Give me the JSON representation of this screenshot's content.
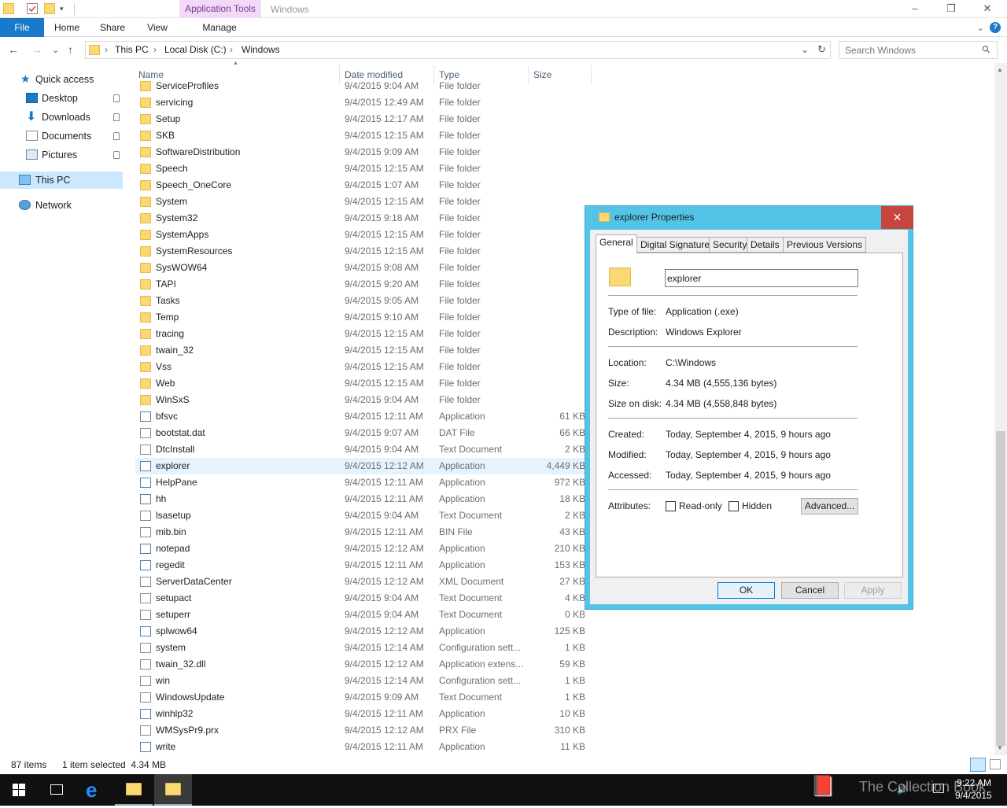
{
  "titlebar": {
    "context_tab": "Application Tools",
    "window_title": "Windows",
    "min": "–",
    "restore": "❐",
    "close": "✕"
  },
  "ribbon": {
    "tabs": [
      "File",
      "Home",
      "Share",
      "View",
      "Manage"
    ],
    "expand_icon": "⌄",
    "help_icon": "?"
  },
  "nav": {
    "back": "←",
    "forward": "→",
    "recent": "⌄",
    "up": "↑",
    "crumbs": [
      "This PC",
      "Local Disk (C:)",
      "Windows"
    ],
    "separator": "›",
    "dropdown": "⌄",
    "refresh": "↻",
    "search_placeholder": "Search Windows",
    "search_icon": "⚲"
  },
  "sidebar": {
    "items": [
      {
        "label": "Quick access",
        "icon": "star-icon"
      },
      {
        "label": "Desktop",
        "icon": "desktop-icon",
        "pinned": true
      },
      {
        "label": "Downloads",
        "icon": "downloads-icon",
        "pinned": true
      },
      {
        "label": "Documents",
        "icon": "documents-icon",
        "pinned": true
      },
      {
        "label": "Pictures",
        "icon": "pictures-icon",
        "pinned": true
      },
      {
        "label": "This PC",
        "icon": "computer-icon",
        "selected": true
      },
      {
        "label": "Network",
        "icon": "network-icon"
      }
    ]
  },
  "list": {
    "columns": [
      "Name",
      "Date modified",
      "Type",
      "Size"
    ],
    "sort_indicator": "▲",
    "rows": [
      {
        "name": "ServiceProfiles",
        "date": "9/4/2015 9:04 AM",
        "type": "File folder",
        "size": "",
        "kind": "folder"
      },
      {
        "name": "servicing",
        "date": "9/4/2015 12:49 AM",
        "type": "File folder",
        "size": "",
        "kind": "folder"
      },
      {
        "name": "Setup",
        "date": "9/4/2015 12:17 AM",
        "type": "File folder",
        "size": "",
        "kind": "folder"
      },
      {
        "name": "SKB",
        "date": "9/4/2015 12:15 AM",
        "type": "File folder",
        "size": "",
        "kind": "folder"
      },
      {
        "name": "SoftwareDistribution",
        "date": "9/4/2015 9:09 AM",
        "type": "File folder",
        "size": "",
        "kind": "folder"
      },
      {
        "name": "Speech",
        "date": "9/4/2015 12:15 AM",
        "type": "File folder",
        "size": "",
        "kind": "folder"
      },
      {
        "name": "Speech_OneCore",
        "date": "9/4/2015 1:07 AM",
        "type": "File folder",
        "size": "",
        "kind": "folder"
      },
      {
        "name": "System",
        "date": "9/4/2015 12:15 AM",
        "type": "File folder",
        "size": "",
        "kind": "folder"
      },
      {
        "name": "System32",
        "date": "9/4/2015 9:18 AM",
        "type": "File folder",
        "size": "",
        "kind": "folder"
      },
      {
        "name": "SystemApps",
        "date": "9/4/2015 12:15 AM",
        "type": "File folder",
        "size": "",
        "kind": "folder"
      },
      {
        "name": "SystemResources",
        "date": "9/4/2015 12:15 AM",
        "type": "File folder",
        "size": "",
        "kind": "folder"
      },
      {
        "name": "SysWOW64",
        "date": "9/4/2015 9:08 AM",
        "type": "File folder",
        "size": "",
        "kind": "folder"
      },
      {
        "name": "TAPI",
        "date": "9/4/2015 9:20 AM",
        "type": "File folder",
        "size": "",
        "kind": "folder"
      },
      {
        "name": "Tasks",
        "date": "9/4/2015 9:05 AM",
        "type": "File folder",
        "size": "",
        "kind": "folder"
      },
      {
        "name": "Temp",
        "date": "9/4/2015 9:10 AM",
        "type": "File folder",
        "size": "",
        "kind": "folder"
      },
      {
        "name": "tracing",
        "date": "9/4/2015 12:15 AM",
        "type": "File folder",
        "size": "",
        "kind": "folder"
      },
      {
        "name": "twain_32",
        "date": "9/4/2015 12:15 AM",
        "type": "File folder",
        "size": "",
        "kind": "folder"
      },
      {
        "name": "Vss",
        "date": "9/4/2015 12:15 AM",
        "type": "File folder",
        "size": "",
        "kind": "folder"
      },
      {
        "name": "Web",
        "date": "9/4/2015 12:15 AM",
        "type": "File folder",
        "size": "",
        "kind": "folder"
      },
      {
        "name": "WinSxS",
        "date": "9/4/2015 9:04 AM",
        "type": "File folder",
        "size": "",
        "kind": "folder"
      },
      {
        "name": "bfsvc",
        "date": "9/4/2015 12:11 AM",
        "type": "Application",
        "size": "61 KB",
        "kind": "app"
      },
      {
        "name": "bootstat.dat",
        "date": "9/4/2015 9:07 AM",
        "type": "DAT File",
        "size": "66 KB",
        "kind": "doc"
      },
      {
        "name": "DtcInstall",
        "date": "9/4/2015 9:04 AM",
        "type": "Text Document",
        "size": "2 KB",
        "kind": "doc"
      },
      {
        "name": "explorer",
        "date": "9/4/2015 12:12 AM",
        "type": "Application",
        "size": "4,449 KB",
        "kind": "app",
        "selected": true
      },
      {
        "name": "HelpPane",
        "date": "9/4/2015 12:11 AM",
        "type": "Application",
        "size": "972 KB",
        "kind": "app"
      },
      {
        "name": "hh",
        "date": "9/4/2015 12:11 AM",
        "type": "Application",
        "size": "18 KB",
        "kind": "app"
      },
      {
        "name": "lsasetup",
        "date": "9/4/2015 9:04 AM",
        "type": "Text Document",
        "size": "2 KB",
        "kind": "doc"
      },
      {
        "name": "mib.bin",
        "date": "9/4/2015 12:11 AM",
        "type": "BIN File",
        "size": "43 KB",
        "kind": "doc"
      },
      {
        "name": "notepad",
        "date": "9/4/2015 12:12 AM",
        "type": "Application",
        "size": "210 KB",
        "kind": "app"
      },
      {
        "name": "regedit",
        "date": "9/4/2015 12:11 AM",
        "type": "Application",
        "size": "153 KB",
        "kind": "app"
      },
      {
        "name": "ServerDataCenter",
        "date": "9/4/2015 12:12 AM",
        "type": "XML Document",
        "size": "27 KB",
        "kind": "doc"
      },
      {
        "name": "setupact",
        "date": "9/4/2015 9:04 AM",
        "type": "Text Document",
        "size": "4 KB",
        "kind": "doc"
      },
      {
        "name": "setuperr",
        "date": "9/4/2015 9:04 AM",
        "type": "Text Document",
        "size": "0 KB",
        "kind": "doc"
      },
      {
        "name": "splwow64",
        "date": "9/4/2015 12:12 AM",
        "type": "Application",
        "size": "125 KB",
        "kind": "app"
      },
      {
        "name": "system",
        "date": "9/4/2015 12:14 AM",
        "type": "Configuration sett...",
        "size": "1 KB",
        "kind": "doc"
      },
      {
        "name": "twain_32.dll",
        "date": "9/4/2015 12:12 AM",
        "type": "Application extens...",
        "size": "59 KB",
        "kind": "doc"
      },
      {
        "name": "win",
        "date": "9/4/2015 12:14 AM",
        "type": "Configuration sett...",
        "size": "1 KB",
        "kind": "doc"
      },
      {
        "name": "WindowsUpdate",
        "date": "9/4/2015 9:09 AM",
        "type": "Text Document",
        "size": "1 KB",
        "kind": "doc"
      },
      {
        "name": "winhlp32",
        "date": "9/4/2015 12:11 AM",
        "type": "Application",
        "size": "10 KB",
        "kind": "app"
      },
      {
        "name": "WMSysPr9.prx",
        "date": "9/4/2015 12:12 AM",
        "type": "PRX File",
        "size": "310 KB",
        "kind": "doc"
      },
      {
        "name": "write",
        "date": "9/4/2015 12:11 AM",
        "type": "Application",
        "size": "11 KB",
        "kind": "app"
      }
    ]
  },
  "status": {
    "item_count": "87 items",
    "selection": "1 item selected  4.34 MB"
  },
  "taskbar": {
    "time": "9:22 AM",
    "date": "9/4/2015",
    "watermark": "The Collection Book"
  },
  "dialog": {
    "title": "explorer Properties",
    "close": "✕",
    "tabs": [
      "General",
      "Digital Signatures",
      "Security",
      "Details",
      "Previous Versions"
    ],
    "filename": "explorer",
    "type_label": "Type of file:",
    "type_value": "Application (.exe)",
    "desc_label": "Description:",
    "desc_value": "Windows Explorer",
    "location_label": "Location:",
    "location_value": "C:\\Windows",
    "size_label": "Size:",
    "size_value": "4.34 MB (4,555,136 bytes)",
    "disk_label": "Size on disk:",
    "disk_value": "4.34 MB (4,558,848 bytes)",
    "created_label": "Created:",
    "created_value": "Today, September 4, 2015, 9 hours ago",
    "modified_label": "Modified:",
    "modified_value": "Today, September 4, 2015, 9 hours ago",
    "accessed_label": "Accessed:",
    "accessed_value": "Today, September 4, 2015, 9 hours ago",
    "attributes_label": "Attributes:",
    "readonly_label": "Read-only",
    "hidden_label": "Hidden",
    "advanced_label": "Advanced...",
    "ok_label": "OK",
    "cancel_label": "Cancel",
    "apply_label": "Apply"
  },
  "colors": {
    "accent": "#1979ca",
    "selection": "#cce8ff",
    "dialog_frame": "#54c4e6",
    "close_red": "#c7453f"
  }
}
